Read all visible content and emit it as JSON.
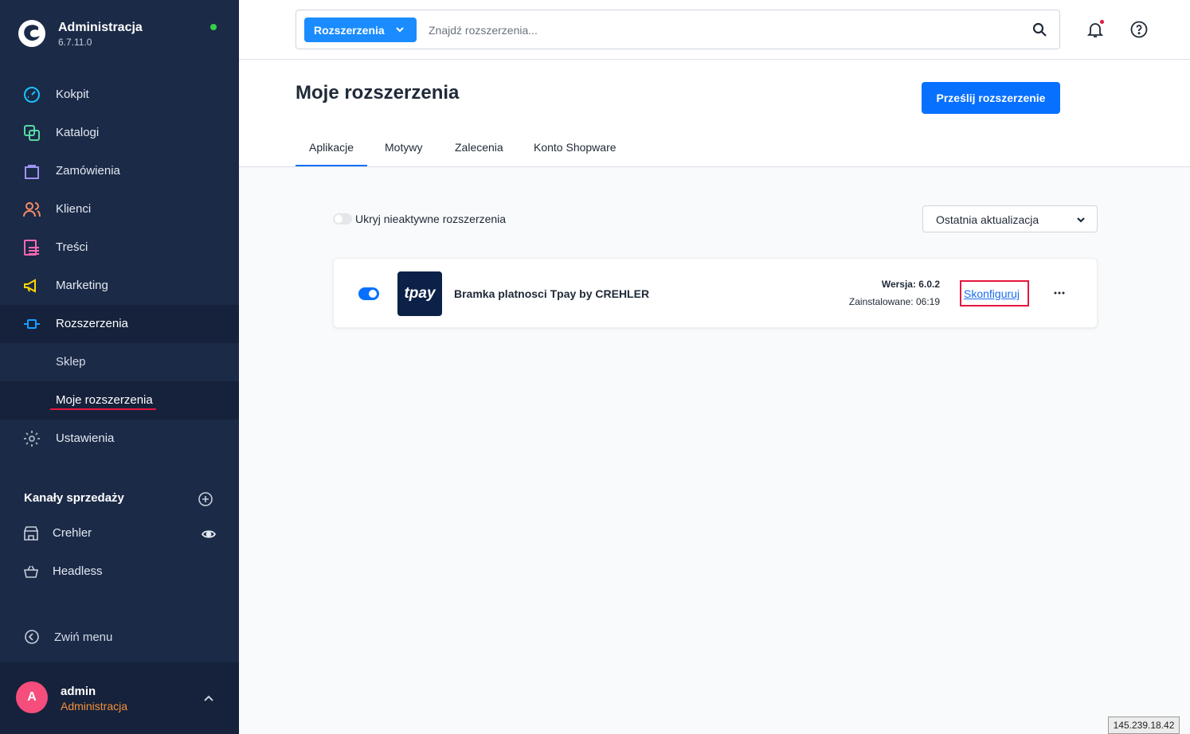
{
  "sidebar": {
    "title": "Administracja",
    "version": "6.7.11.0",
    "items": [
      {
        "label": "Kokpit",
        "icon": "gauge-icon",
        "color": "#19c3ff"
      },
      {
        "label": "Katalogi",
        "icon": "catalog-icon",
        "color": "#57d9a3"
      },
      {
        "label": "Zamówienia",
        "icon": "shopping-bag-icon",
        "color": "#a092f0"
      },
      {
        "label": "Klienci",
        "icon": "users-icon",
        "color": "#f88962"
      },
      {
        "label": "Treści",
        "icon": "content-icon",
        "color": "#ff68b4"
      },
      {
        "label": "Marketing",
        "icon": "megaphone-icon",
        "color": "#ffd700"
      },
      {
        "label": "Rozszerzenia",
        "icon": "plug-icon",
        "color": "#189eff"
      },
      {
        "label": "Ustawienia",
        "icon": "gear-icon",
        "color": "#9aa8b5"
      }
    ],
    "subitems": [
      {
        "label": "Sklep"
      },
      {
        "label": "Moje rozszerzenia"
      }
    ],
    "channels_title": "Kanały sprzedaży",
    "channels": [
      {
        "label": "Crehler",
        "icon": "storefront-icon"
      },
      {
        "label": "Headless",
        "icon": "basket-icon"
      }
    ],
    "collapse_label": "Zwiń menu",
    "user": {
      "initial": "A",
      "name": "admin",
      "role": "Administracja"
    }
  },
  "topbar": {
    "search_type": "Rozszerzenia",
    "search_placeholder": "Znajdź rozszerzenia..."
  },
  "page": {
    "title": "Moje rozszerzenia",
    "upload_button": "Prześlij rozszerzenie",
    "tabs": [
      {
        "label": "Aplikacje",
        "active": true
      },
      {
        "label": "Motywy",
        "active": false
      },
      {
        "label": "Zalecenia",
        "active": false
      },
      {
        "label": "Konto Shopware",
        "active": false
      }
    ]
  },
  "filters": {
    "hide_inactive_label": "Ukryj nieaktywne rozszerzenia",
    "hide_inactive": false,
    "sort_label": "Ostatnia aktualizacja"
  },
  "extensions": [
    {
      "logo_text": "tpay",
      "name": "Bramka platnosci Tpay by CREHLER",
      "version": "Wersja: 6.0.2",
      "installed": "Zainstalowane: 06:19",
      "configure_label": "Skonfiguruj",
      "active": true
    }
  ],
  "ip_badge": "145.239.18.42",
  "colors": {
    "sidebar_bg": "#1b2a47",
    "primary": "#0870ff",
    "highlight_red": "#e5173d",
    "user_role": "#f5913b"
  }
}
